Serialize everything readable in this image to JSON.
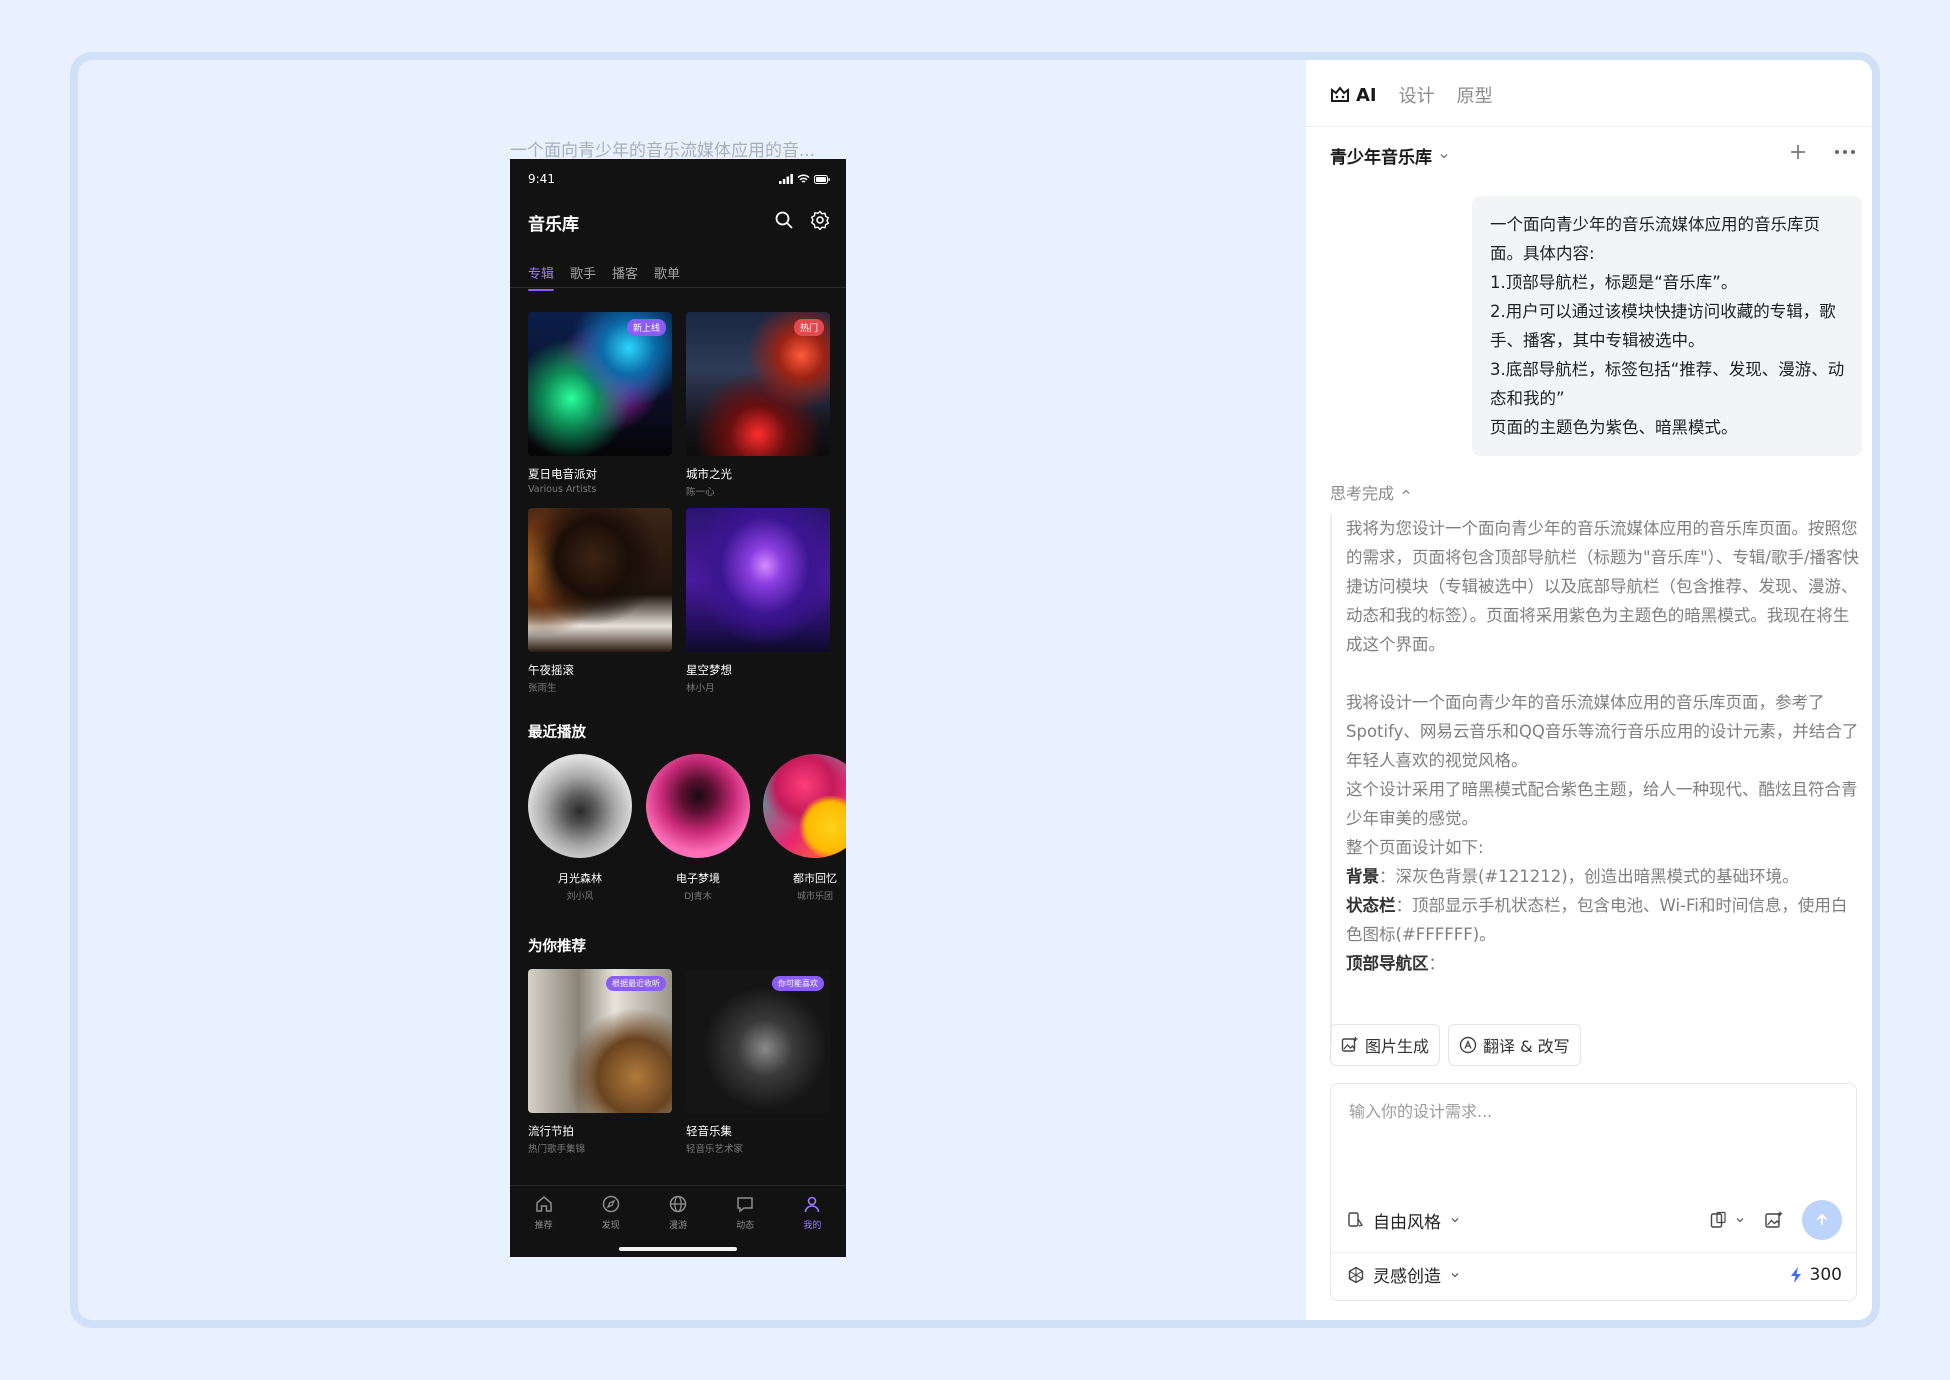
{
  "canvas": {
    "caption": "一个面向青少年的音乐流媒体应用的音..."
  },
  "phone": {
    "status": {
      "time": "9:41"
    },
    "nav": {
      "title": "音乐库",
      "search_icon": "search-icon",
      "settings_icon": "gear-icon"
    },
    "tabs": [
      {
        "label": "专辑",
        "active": true
      },
      {
        "label": "歌手",
        "active": false
      },
      {
        "label": "播客",
        "active": false
      },
      {
        "label": "歌单",
        "active": false
      }
    ],
    "albums": [
      {
        "title": "夏日电音派对",
        "subtitle": "Various Artists",
        "badge": "新上线",
        "badge_color": "#8b5cf6"
      },
      {
        "title": "城市之光",
        "subtitle": "陈一心",
        "badge": "热门",
        "badge_color": "#e5484d"
      },
      {
        "title": "午夜摇滚",
        "subtitle": "张雨生",
        "badge": "",
        "badge_color": ""
      },
      {
        "title": "星空梦想",
        "subtitle": "林小月",
        "badge": "",
        "badge_color": ""
      }
    ],
    "recent_title": "最近播放",
    "recent": [
      {
        "title": "月光森林",
        "subtitle": "刘小风"
      },
      {
        "title": "电子梦境",
        "subtitle": "DJ青木"
      },
      {
        "title": "都市回忆",
        "subtitle": "城市乐团"
      }
    ],
    "recommend_title": "为你推荐",
    "recommend": [
      {
        "title": "流行节拍",
        "subtitle": "热门歌手集锦",
        "badge": "根据最近收听",
        "badge_color": "#8b5cf6"
      },
      {
        "title": "轻音乐集",
        "subtitle": "轻音乐艺术家",
        "badge": "你可能喜欢",
        "badge_color": "#8b5cf6"
      }
    ],
    "bottom_nav": [
      {
        "label": "推荐",
        "icon": "home-icon",
        "active": false
      },
      {
        "label": "发现",
        "icon": "compass-icon",
        "active": false
      },
      {
        "label": "漫游",
        "icon": "globe-icon",
        "active": false
      },
      {
        "label": "动态",
        "icon": "chat-icon",
        "active": false
      },
      {
        "label": "我的",
        "icon": "user-icon",
        "active": true
      }
    ],
    "theme_color": "#8b5cf6",
    "background": "#121212"
  },
  "panel": {
    "tabs": {
      "ai": "AI",
      "design": "设计",
      "prototype": "原型"
    },
    "project_title": "青少年音乐库",
    "user_message": [
      "一个面向青少年的音乐流媒体应用的音乐库页面。具体内容:",
      "1.顶部导航栏，标题是“音乐库”。",
      "2.用户可以通过该模块快捷访问收藏的专辑，歌手、播客，其中专辑被选中。",
      "3.底部导航栏，标签包括“推荐、发现、漫游、动态和我的”",
      "页面的主题色为紫色、暗黑模式。"
    ],
    "thinking_label": "思考完成",
    "thinking": {
      "p1": "我将为您设计一个面向青少年的音乐流媒体应用的音乐库页面。按照您的需求，页面将包含顶部导航栏（标题为\"音乐库\"）、专辑/歌手/播客快捷访问模块（专辑被选中）以及底部导航栏（包含推荐、发现、漫游、动态和我的标签）。页面将采用紫色为主题色的暗黑模式。我现在将生成这个界面。",
      "p2": "我将设计一个面向青少年的音乐流媒体应用的音乐库页面，参考了Spotify、网易云音乐和QQ音乐等流行音乐应用的设计元素，并结合了年轻人喜欢的视觉风格。",
      "p3": "这个设计采用了暗黑模式配合紫色主题，给人一种现代、酷炫且符合青少年审美的感觉。",
      "p4": "整个页面设计如下:",
      "bg_label": "背景",
      "bg_text": "：深灰色背景(#121212)，创造出暗黑模式的基础环境。",
      "status_label": "状态栏",
      "status_text": "：顶部显示手机状态栏，包含电池、Wi-Fi和时间信息，使用白色图标(#FFFFFF)。",
      "nav_label": "顶部导航区",
      "nav_text": "："
    },
    "chips": [
      {
        "label": "图片生成",
        "icon": "image-gen-icon"
      },
      {
        "label": "翻译 & 改写",
        "icon": "translate-icon"
      }
    ],
    "input": {
      "placeholder": "输入你的设计需求...",
      "style_label": "自由风格",
      "inspiration_label": "灵感创造",
      "credits": "300"
    },
    "accent": "#3b6ef5"
  }
}
